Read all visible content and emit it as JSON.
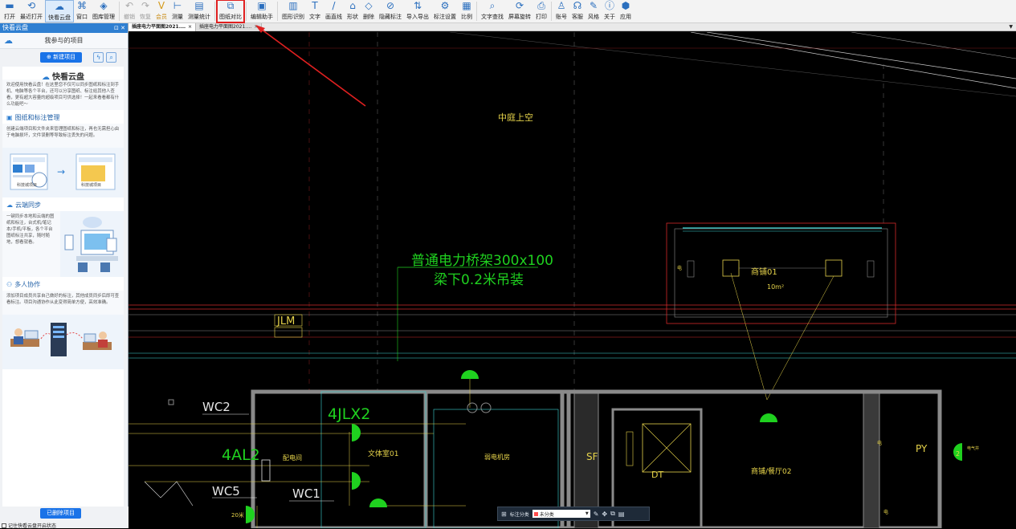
{
  "toolbar": {
    "items": [
      {
        "label": "打开",
        "icon": "folder-open-icon",
        "glyph": "▬"
      },
      {
        "label": "最近打开",
        "icon": "history-icon",
        "glyph": "⟲"
      },
      {
        "label": "快看云盘",
        "icon": "cloud-icon",
        "glyph": "☁"
      },
      {
        "label": "窗口",
        "icon": "window-icon",
        "glyph": "⌘"
      },
      {
        "label": "图库管理",
        "icon": "library-icon",
        "glyph": "◈"
      },
      {
        "label": "撤销",
        "icon": "undo-icon",
        "glyph": "↶"
      },
      {
        "label": "恢复",
        "icon": "redo-icon",
        "glyph": "↷"
      },
      {
        "label": "会员",
        "icon": "vip-icon",
        "glyph": "V"
      },
      {
        "label": "测量",
        "icon": "measure-icon",
        "glyph": "⊢"
      },
      {
        "label": "测量统计",
        "icon": "measure-stats-icon",
        "glyph": "▤"
      },
      {
        "label": "图纸对比",
        "icon": "compare-icon",
        "glyph": "⧉"
      },
      {
        "label": "编辑助手",
        "icon": "edit-assistant-icon",
        "glyph": "▣"
      },
      {
        "label": "图形识别",
        "icon": "shape-recognition-icon",
        "glyph": "▥"
      },
      {
        "label": "文字",
        "icon": "text-icon",
        "glyph": "T"
      },
      {
        "label": "画直线",
        "icon": "line-icon",
        "glyph": "/"
      },
      {
        "label": "形状",
        "icon": "shape-icon",
        "glyph": "⌂"
      },
      {
        "label": "删除",
        "icon": "eraser-icon",
        "glyph": "◇"
      },
      {
        "label": "隐藏标注",
        "icon": "hide-annotation-icon",
        "glyph": "⊘"
      },
      {
        "label": "导入导出",
        "icon": "import-export-icon",
        "glyph": "⇅"
      },
      {
        "label": "标注设置",
        "icon": "annotation-settings-icon",
        "glyph": "⚙"
      },
      {
        "label": "比例",
        "icon": "scale-icon",
        "glyph": "▦"
      },
      {
        "label": "文字查找",
        "icon": "text-search-icon",
        "glyph": "⌕"
      },
      {
        "label": "屏幕旋转",
        "icon": "rotate-icon",
        "glyph": "⟳"
      },
      {
        "label": "打印",
        "icon": "print-icon",
        "glyph": "⎙"
      },
      {
        "label": "账号",
        "icon": "account-icon",
        "glyph": "♙"
      },
      {
        "label": "客服",
        "icon": "headset-icon",
        "glyph": "☊"
      },
      {
        "label": "风格",
        "icon": "style-icon",
        "glyph": "✎"
      },
      {
        "label": "关于",
        "icon": "info-icon",
        "glyph": "ⓘ"
      },
      {
        "label": "应用",
        "icon": "apps-icon",
        "glyph": "⬢"
      }
    ]
  },
  "tabs": [
    {
      "label": "插座电力平面图2021.…",
      "close": "×"
    },
    {
      "label": "插座电力平面图2021.…",
      "close": "×"
    }
  ],
  "tab_menu": "▼",
  "panel": {
    "title": "快看云盘",
    "title_controls": "⊡ ✕",
    "project_label": "我参与的项目",
    "new_project_button": "⊕ 新建项目",
    "sync_glyph": "ϟ",
    "search_glyph": "⌕",
    "brand": "快看云盘",
    "intro": "欢迎使用快看云盘！在这里您不仅可以同步图纸和标注到手机、电脑等各个平台，还可以分享图纸、标注给其他人查看，更有超大容量的超级项目可供选择！一起来看看都有什么功能吧～",
    "sections": [
      {
        "title": "图纸和标注管理",
        "icon": "drawing-manage-icon",
        "glyph": "▣",
        "text": "创建云端项目和文件夹来管理图纸和标注，再也无需担心由于电脑损坏，文件误删等导致标注丢失的问题。"
      },
      {
        "title": "云端同步",
        "icon": "cloud-sync-icon",
        "glyph": "☁",
        "text": "一键同步本地和云端的图纸和标注，台式机/笔记本/手机/平板，各个平台图纸标注共享，随时随地，想看就看。"
      },
      {
        "title": "多人协作",
        "icon": "collaboration-icon",
        "glyph": "⚇",
        "text": "添加项目成员共享自己做好的标注，其他成员同步后即可查看标注。项目沟通协作从此变得简单方便，高效准确。"
      }
    ],
    "illus_labels": [
      "科技城项目",
      "科技城项目"
    ],
    "deleted_button": "已删除项目",
    "remember_label": "记住快看云盘开启状态"
  },
  "drawing": {
    "labels": {
      "label_top": "中庭上空",
      "bridge_line1": "普通电力桥架300x100",
      "bridge_line2": "梁下0.2米吊装",
      "jlm": "JLM",
      "wc2": "WC2",
      "al2": "4AL2",
      "jlx2": "4JLX2",
      "wc5": "WC5",
      "wc1": "WC1",
      "sf": "SF",
      "dt": "DT",
      "py": "PY",
      "room_a": "配电间",
      "room_b": "文体室01",
      "room_c": "弱电机房",
      "room_d": "商铺/餐厅02",
      "room_e": "商铺01",
      "area": "10m²",
      "small_a": "电",
      "small_b": "电",
      "small_c": "电",
      "wcc": "20米",
      "sw": "2",
      "small_right": "电气井"
    }
  },
  "bottombar": {
    "label": "标注分类",
    "selected": "未分类",
    "arrow": "▼",
    "icons": [
      "✎",
      "✥",
      "⧉",
      "▤"
    ]
  },
  "colors": {
    "accent": "#2f7fd1",
    "cad_yellow": "#e6d34a",
    "cad_cyan": "#3fd6d6",
    "cad_red": "#d22a2a",
    "cad_green": "#1fd11f",
    "cad_gray": "#8a8a8a",
    "annotation_red": "#e02020"
  }
}
